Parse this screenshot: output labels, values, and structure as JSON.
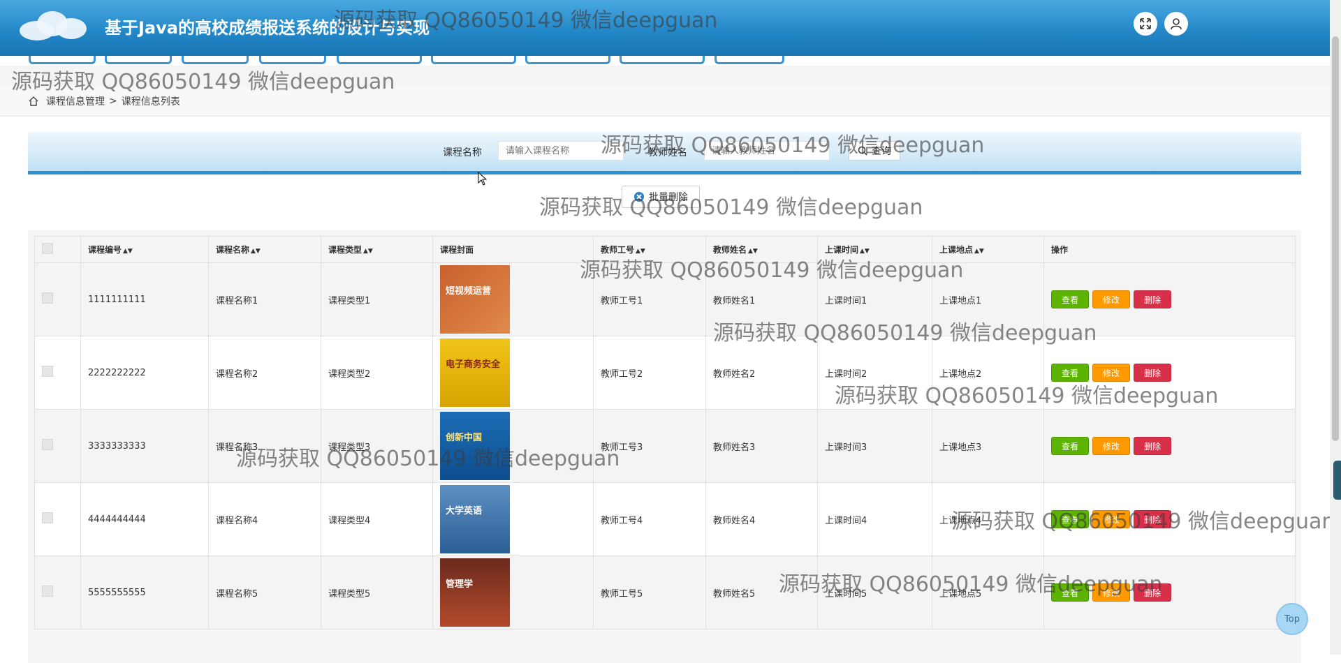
{
  "app": {
    "title": "基于Java的高校成绩报送系统的设计与实现"
  },
  "header": {
    "fullscreen_icon": "expand-icon",
    "user_icon": "user-icon"
  },
  "breadcrumb": {
    "home_icon": "home-icon",
    "parent": "课程信息管理",
    "separator": ">",
    "current": "课程信息列表"
  },
  "search": {
    "course_name_label": "课程名称",
    "course_name_placeholder": "请输入课程名称",
    "teacher_name_label": "教师姓名",
    "teacher_name_placeholder": "请输入教师姓名",
    "query_button": "查询"
  },
  "toolbar": {
    "batch_delete": "批量删除"
  },
  "table": {
    "columns": [
      "课程编号",
      "课程名称",
      "课程类型",
      "课程封面",
      "教师工号",
      "教师姓名",
      "上课时间",
      "上课地点",
      "操作"
    ],
    "actions": {
      "view": "查看",
      "edit": "修改",
      "delete": "删除"
    },
    "rows": [
      {
        "code": "1111111111",
        "name": "课程名称1",
        "type": "课程类型1",
        "cover_text": "短视频运营",
        "teacher_no": "教师工号1",
        "teacher_name": "教师姓名1",
        "time": "上课时间1",
        "place": "上课地点1"
      },
      {
        "code": "2222222222",
        "name": "课程名称2",
        "type": "课程类型2",
        "cover_text": "电子商务安全",
        "teacher_no": "教师工号2",
        "teacher_name": "教师姓名2",
        "time": "上课时间2",
        "place": "上课地点2"
      },
      {
        "code": "3333333333",
        "name": "课程名称3",
        "type": "课程类型3",
        "cover_text": "创新中国",
        "teacher_no": "教师工号3",
        "teacher_name": "教师姓名3",
        "time": "上课时间3",
        "place": "上课地点3"
      },
      {
        "code": "4444444444",
        "name": "课程名称4",
        "type": "课程类型4",
        "cover_text": "大学英语",
        "teacher_no": "教师工号4",
        "teacher_name": "教师姓名4",
        "time": "上课时间4",
        "place": "上课地点4"
      },
      {
        "code": "5555555555",
        "name": "课程名称5",
        "type": "课程类型5",
        "cover_text": "管理学",
        "teacher_no": "教师工号5",
        "teacher_name": "教师姓名5",
        "time": "上课时间5",
        "place": "上课地点5"
      }
    ]
  },
  "watermark": "源码获取 QQ86050149 微信deepguan",
  "back_to_top": "Top",
  "colors": {
    "header": "#2388c8",
    "view": "#5cb300",
    "edit": "#ff9900",
    "delete": "#d9304a"
  }
}
